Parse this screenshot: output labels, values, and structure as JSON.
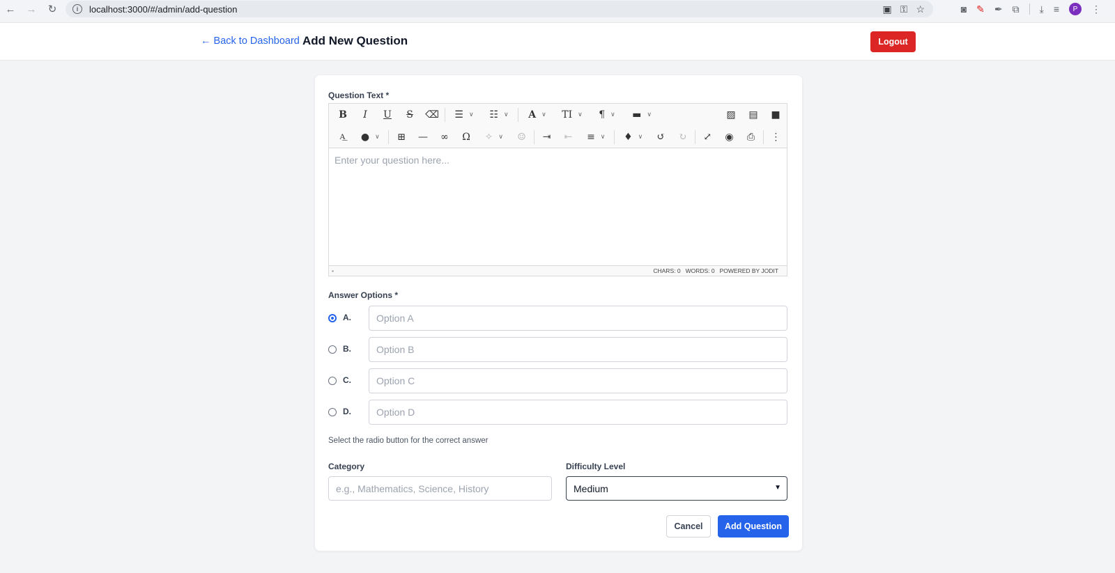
{
  "browser": {
    "url": "localhost:3000/#/admin/add-question",
    "profile_initial": "P"
  },
  "header": {
    "back_link": "← Back to Dashboard",
    "title": "Add New Question",
    "logout_label": "Logout",
    "logout_color": "#dc2626"
  },
  "form": {
    "question_label": "Question Text *",
    "editor": {
      "placeholder": "Enter your question here...",
      "chars": "CHARS: 0",
      "words": "WORDS: 0",
      "powered_by": "POWERED BY JODIT",
      "toolbar_row1": [
        "bold-icon",
        "italic-icon",
        "underline-icon",
        "strikethrough-icon",
        "eraser-icon",
        "bullet-list-icon",
        "numbered-list-icon",
        "font-color-icon",
        "font-size-icon",
        "paragraph-icon",
        "classes-icon",
        "image-icon",
        "file-icon",
        "video-icon"
      ],
      "toolbar_row2": [
        "spellcheck-icon",
        "microphone-icon",
        "table-icon",
        "horizontal-rule-icon",
        "link-icon",
        "symbol-icon",
        "ai-assistant-icon",
        "ai-commands-icon",
        "indent-icon",
        "outdent-icon",
        "align-icon",
        "brush-icon",
        "undo-icon",
        "redo-icon",
        "fullsize-icon",
        "preview-icon",
        "print-icon",
        "more-icon"
      ]
    },
    "answers_label": "Answer Options *",
    "options": [
      {
        "letter": "A.",
        "placeholder": "Option A",
        "value": "",
        "checked": true
      },
      {
        "letter": "B.",
        "placeholder": "Option B",
        "value": "",
        "checked": false
      },
      {
        "letter": "C.",
        "placeholder": "Option C",
        "value": "",
        "checked": false
      },
      {
        "letter": "D.",
        "placeholder": "Option D",
        "value": "",
        "checked": false
      }
    ],
    "help_text": "Select the radio button for the correct answer",
    "category_label": "Category",
    "category_placeholder": "e.g., Mathematics, Science, History",
    "category_value": "",
    "difficulty_label": "Difficulty Level",
    "difficulty_value": "Medium",
    "cancel_label": "Cancel",
    "submit_label": "Add Question",
    "accent_color": "#2563eb"
  }
}
